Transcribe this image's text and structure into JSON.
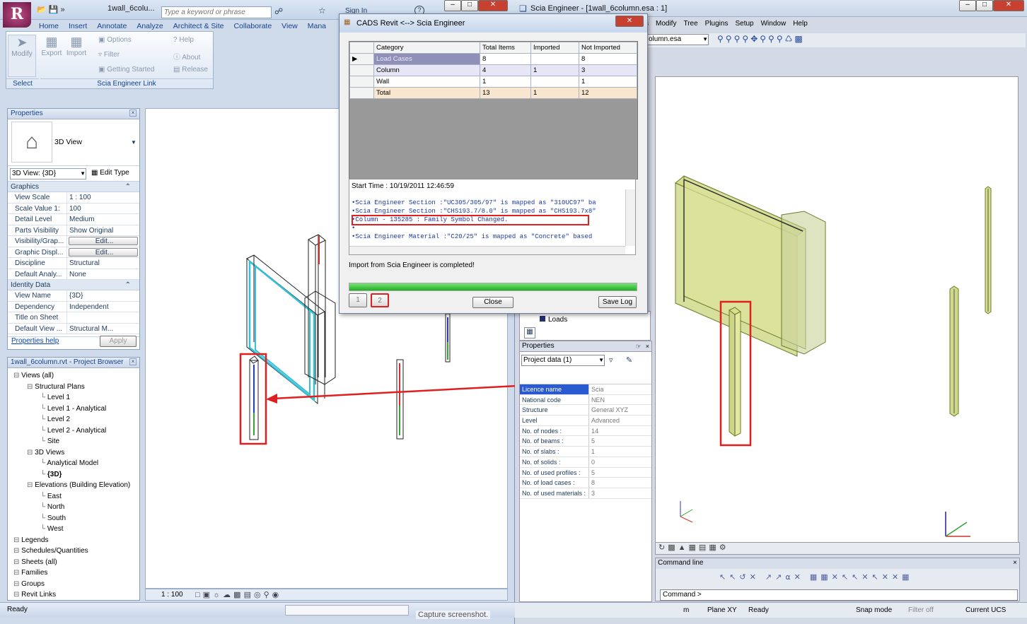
{
  "revit": {
    "title": "1wall_6colu...",
    "search_placeholder": "Type a keyword or phrase",
    "signin": "Sign In",
    "tabs": [
      "Home",
      "Insert",
      "Annotate",
      "Analyze",
      "Architect & Site",
      "Collaborate",
      "View",
      "Mana"
    ],
    "ribbon": {
      "modify": "Modify",
      "export": "Export",
      "import": "Import",
      "options": "Options",
      "filter": "Filter",
      "getting_started": "Getting Started",
      "help": "Help",
      "about": "About",
      "release": "Release",
      "select_label": "Select",
      "panel_label": "Scia Engineer Link"
    },
    "properties": {
      "title": "Properties",
      "type_name": "3D View",
      "view_selector": "3D View: {3D}",
      "edit_type": "Edit Type",
      "graphics_header": "Graphics",
      "identity_header": "Identity Data",
      "rows_graphics": [
        {
          "k": "View Scale",
          "v": "1 : 100"
        },
        {
          "k": "Scale Value    1:",
          "v": "100"
        },
        {
          "k": "Detail Level",
          "v": "Medium"
        },
        {
          "k": "Parts Visibility",
          "v": "Show Original"
        },
        {
          "k": "Visibility/Grap...",
          "v": "Edit..."
        },
        {
          "k": "Graphic Displ...",
          "v": "Edit..."
        },
        {
          "k": "Discipline",
          "v": "Structural"
        },
        {
          "k": "Default Analy...",
          "v": "None"
        }
      ],
      "rows_identity": [
        {
          "k": "View Name",
          "v": "{3D}"
        },
        {
          "k": "Dependency",
          "v": "Independent"
        },
        {
          "k": "Title on Sheet",
          "v": ""
        },
        {
          "k": "Default View ...",
          "v": "Structural M..."
        }
      ],
      "help_link": "Properties help",
      "apply": "Apply"
    },
    "browser": {
      "title": "1wall_6column.rvt - Project Browser",
      "items": [
        {
          "t": "Views (all)",
          "l": 0
        },
        {
          "t": "Structural Plans",
          "l": 1
        },
        {
          "t": "Level 1",
          "l": 2
        },
        {
          "t": "Level 1 - Analytical",
          "l": 2
        },
        {
          "t": "Level 2",
          "l": 2
        },
        {
          "t": "Level 2 - Analytical",
          "l": 2
        },
        {
          "t": "Site",
          "l": 2
        },
        {
          "t": "3D Views",
          "l": 1
        },
        {
          "t": "Analytical Model",
          "l": 2
        },
        {
          "t": "{3D}",
          "l": 2
        },
        {
          "t": "Elevations (Building Elevation)",
          "l": 1
        },
        {
          "t": "East",
          "l": 2
        },
        {
          "t": "North",
          "l": 2
        },
        {
          "t": "South",
          "l": 2
        },
        {
          "t": "West",
          "l": 2
        },
        {
          "t": "Legends",
          "l": 0
        },
        {
          "t": "Schedules/Quantities",
          "l": 0
        },
        {
          "t": "Sheets (all)",
          "l": 0
        },
        {
          "t": "Families",
          "l": 0
        },
        {
          "t": "Groups",
          "l": 0
        },
        {
          "t": "Revit Links",
          "l": 0
        }
      ]
    },
    "view_scale": "1 : 100",
    "status": "Ready"
  },
  "dialog": {
    "title": "CADS Revit <--> Scia Engineer",
    "headers": [
      "Category",
      "Total Items",
      "Imported",
      "Not Imported"
    ],
    "rows": [
      [
        "Load Cases",
        "8",
        "",
        "8"
      ],
      [
        "Column",
        "4",
        "1",
        "3"
      ],
      [
        "Wall",
        "1",
        "",
        "1"
      ],
      [
        "Total",
        "13",
        "1",
        "12"
      ]
    ],
    "start_time": "Start Time : 10/19/2011 12:46:59",
    "log": [
      "Scia Engineer Section :\"UC305/305/97\" is mapped as \"310UC97\" ba",
      "Scia Engineer Section :\"CHS193.7/8.0\" is mapped as \"CHS193.7x8\"",
      "Column              - 135285 : Family Symbol Changed.",
      "",
      "Scia Engineer Material :\"C20/25\" is mapped as \"Concrete\" based"
    ],
    "completed": "Import from Scia Engineer is completed!",
    "progress": 1.0,
    "page1": "1",
    "page2": "2",
    "close": "Close",
    "save_log": "Save Log"
  },
  "scia": {
    "title": "Scia Engineer - [1wall_6column.esa : 1]",
    "menus": [
      "s",
      "Modify",
      "Tree",
      "Plugins",
      "Setup",
      "Window",
      "Help"
    ],
    "file_combo": "olumn.esa",
    "tree_item": "Loads",
    "properties_title": "Properties",
    "props_combo": "Project data (1)",
    "rows": [
      {
        "k": "Licence name",
        "v": "Scia"
      },
      {
        "k": "National code",
        "v": "NEN"
      },
      {
        "k": "Structure",
        "v": "General XYZ"
      },
      {
        "k": "Level",
        "v": "Advanced"
      },
      {
        "k": "No. of nodes :",
        "v": "14"
      },
      {
        "k": "No. of beams :",
        "v": "5"
      },
      {
        "k": "No. of slabs :",
        "v": "1"
      },
      {
        "k": "No. of solids :",
        "v": "0"
      },
      {
        "k": "No. of used profiles :",
        "v": "5"
      },
      {
        "k": "No. of load cases :",
        "v": "8"
      },
      {
        "k": "No. of used materials :",
        "v": "3"
      }
    ],
    "command_line_title": "Command line",
    "command_prompt": "Command >",
    "status": [
      "m",
      "Plane XY",
      "Ready",
      "Snap mode",
      "Filter off",
      "Current UCS"
    ]
  },
  "capture_text": "Capture screenshot."
}
